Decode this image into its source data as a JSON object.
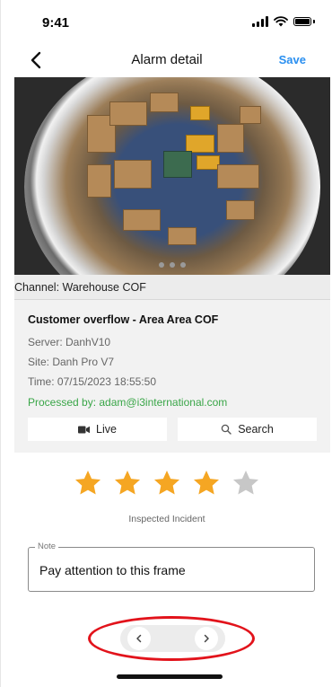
{
  "status_bar": {
    "time": "9:41"
  },
  "nav": {
    "title": "Alarm detail",
    "save_label": "Save"
  },
  "channel": {
    "label": "Channel: Warehouse COF"
  },
  "alarm": {
    "title": "Customer overflow - Area Area COF",
    "server": "Server: DanhV10",
    "site": "Site: Danh Pro V7",
    "time": "Time: 07/15/2023 18:55:50",
    "processed_by": "Processed by: adam@i3international.com"
  },
  "actions": {
    "live_label": "Live",
    "search_label": "Search"
  },
  "rating": {
    "value": 4,
    "max": 5,
    "label": "Inspected Incident"
  },
  "note": {
    "legend": "Note",
    "value": "Pay attention to this frame"
  },
  "colors": {
    "accent": "#2a8ff0",
    "star_active": "#f5a623",
    "star_inactive": "#c7c7c7",
    "processed": "#3aa648",
    "highlight": "#e2131b"
  },
  "icons": {
    "back": "chevron-left-icon",
    "live": "video-camera-icon",
    "search": "search-icon",
    "prev": "chevron-left-icon",
    "next": "chevron-right-icon",
    "star": "star-icon"
  }
}
